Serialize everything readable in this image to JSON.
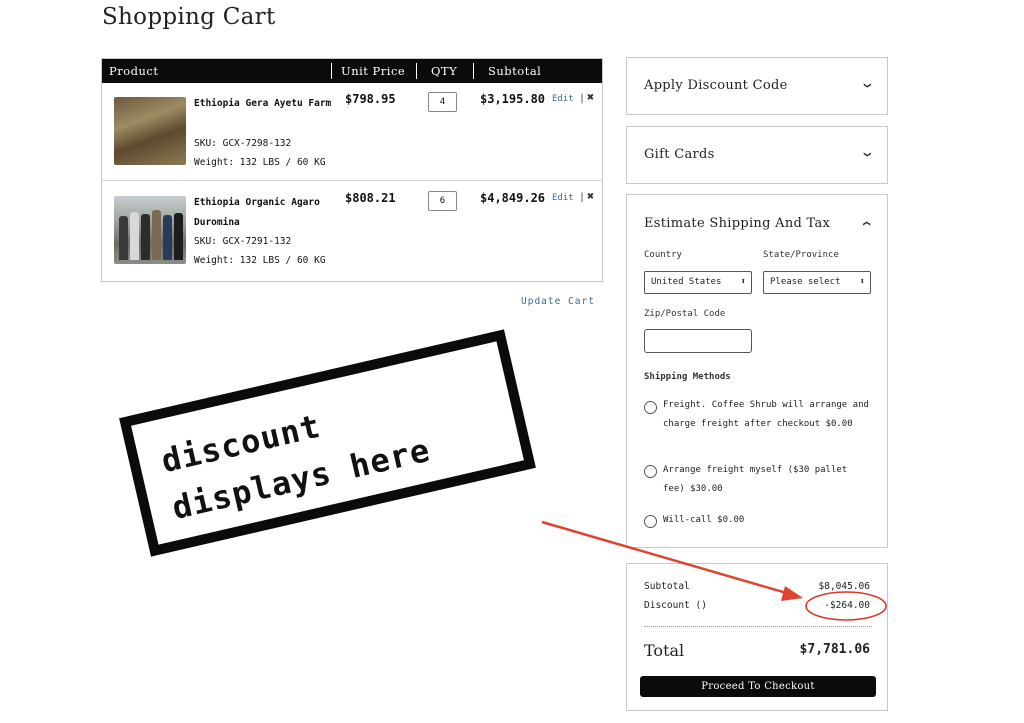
{
  "page": {
    "title": "Shopping Cart"
  },
  "cart": {
    "headers": {
      "product": "Product",
      "unit_price": "Unit Price",
      "qty": "QTY",
      "subtotal": "Subtotal"
    },
    "items": [
      {
        "name": "Ethiopia Gera Ayetu Farm",
        "sku": "SKU: GCX-7298-132",
        "weight": "Weight: 132 LBS / 60 KG",
        "price": "$798.95",
        "qty": "4",
        "subtotal": "$3,195.80",
        "edit": "Edit",
        "remove_icon": "close-x-icon"
      },
      {
        "name": "Ethiopia Organic Agaro Duromina",
        "sku": "SKU: GCX-7291-132",
        "weight": "Weight: 132 LBS / 60 KG",
        "price": "$808.21",
        "qty": "6",
        "subtotal": "$4,849.26",
        "edit": "Edit",
        "remove_icon": "close-x-icon"
      }
    ],
    "update_label": "Update Cart"
  },
  "discount_panel": {
    "title": "Apply Discount Code",
    "icon": "chevron-down-icon"
  },
  "gift_panel": {
    "title": "Gift Cards",
    "icon": "chevron-down-icon"
  },
  "shipping_panel": {
    "title": "Estimate Shipping And Tax",
    "icon": "chevron-up-icon",
    "country_label": "Country",
    "country_value": "United States",
    "state_label": "State/Province",
    "state_value": "Please select",
    "zip_label": "Zip/Postal Code",
    "zip_value": "",
    "methods_label": "Shipping Methods",
    "methods": [
      {
        "text": "Freight. Coffee Shrub will arrange and charge freight after checkout $0.00"
      },
      {
        "text": "Arrange freight myself ($30 pallet fee) $30.00"
      },
      {
        "text": "Will-call $0.00"
      }
    ]
  },
  "totals": {
    "subtotal_label": "Subtotal",
    "subtotal_value": "$8,045.06",
    "discount_label": "Discount ()",
    "discount_value": "-$264.00",
    "total_label": "Total",
    "total_value": "$7,781.06",
    "checkout_label": "Proceed To Checkout"
  },
  "annotation": {
    "line1": "discount",
    "line2": "displays here",
    "arrow_color": "#e0432f",
    "circle_color": "#d93a2c"
  }
}
